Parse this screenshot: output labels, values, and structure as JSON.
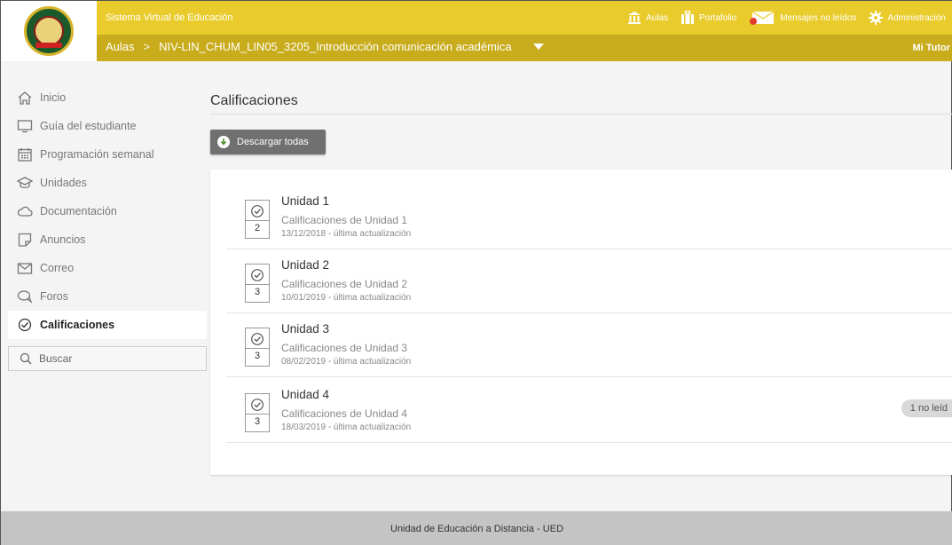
{
  "header": {
    "system_title": "Sistema Virtual de Educación",
    "nav": [
      {
        "label": "Aulas",
        "icon": "building-icon"
      },
      {
        "label": "Portafolio",
        "icon": "briefcase-icon"
      },
      {
        "label": "Mensajes no leídos",
        "icon": "mail-icon"
      },
      {
        "label": "Administración",
        "icon": "gear-icon"
      }
    ],
    "breadcrumb": {
      "root": "Aulas",
      "separator": ">",
      "course": "NIV-LIN_CHUM_LIN05_3205_Introducción comunicación académica"
    },
    "mi_tutor": "Mi Tutor"
  },
  "sidebar": {
    "items": [
      {
        "label": "Inicio",
        "icon": "home-icon"
      },
      {
        "label": "Guía del estudiante",
        "icon": "monitor-icon"
      },
      {
        "label": "Programación semanal",
        "icon": "calendar-icon"
      },
      {
        "label": "Unidades",
        "icon": "graduation-cap-icon"
      },
      {
        "label": "Documentación",
        "icon": "cloud-icon"
      },
      {
        "label": "Anuncios",
        "icon": "note-icon"
      },
      {
        "label": "Correo",
        "icon": "envelope-icon"
      },
      {
        "label": "Foros",
        "icon": "chat-icon"
      },
      {
        "label": "Calificaciones",
        "icon": "check-circle-icon",
        "active": true
      }
    ],
    "search_label": "Buscar"
  },
  "main": {
    "title": "Calificaciones",
    "download_label": "Descargar todas",
    "units": [
      {
        "title": "Unidad 1",
        "subtitle": "Calificaciones de Unidad 1",
        "date": "13/12/2018 - última actualización",
        "count": "2",
        "badge": ""
      },
      {
        "title": "Unidad 2",
        "subtitle": "Calificaciones de Unidad 2",
        "date": "10/01/2019 - última actualización",
        "count": "3",
        "badge": ""
      },
      {
        "title": "Unidad 3",
        "subtitle": "Calificaciones de Unidad 3",
        "date": "08/02/2019 - última actualización",
        "count": "3",
        "badge": ""
      },
      {
        "title": "Unidad 4",
        "subtitle": "Calificaciones de Unidad 4",
        "date": "18/03/2019 - última actualización",
        "count": "3",
        "badge": "1 no leíd"
      }
    ]
  },
  "footer": {
    "text": "Unidad de Educación a Distancia - UED"
  },
  "colors": {
    "header_yellow": "#e9cc2c",
    "header_dark": "#c9ac1c",
    "button_gray": "#707070",
    "footer_gray": "#c4c4c4"
  }
}
